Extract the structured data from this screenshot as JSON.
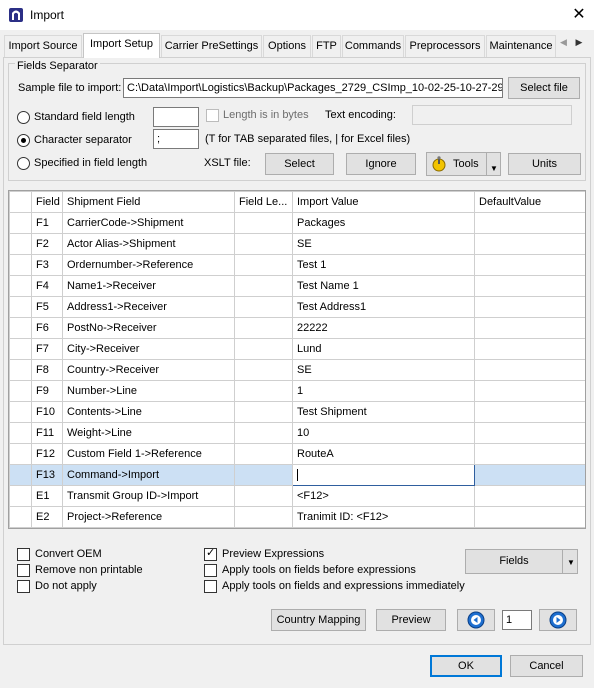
{
  "window": {
    "title": "Import",
    "close_glyph": "✕",
    "icon": "app-logo-icon"
  },
  "tabs": [
    {
      "label": "Import Source",
      "active": false
    },
    {
      "label": "Import Setup",
      "active": true
    },
    {
      "label": "Carrier PreSettings",
      "active": false
    },
    {
      "label": "Options",
      "active": false
    },
    {
      "label": "FTP",
      "active": false
    },
    {
      "label": "Commands",
      "active": false
    },
    {
      "label": "Preprocessors",
      "active": false
    },
    {
      "label": "Maintenance",
      "active": false
    }
  ],
  "tab_scroll": {
    "left": "◀",
    "right": "▶"
  },
  "separator": {
    "legend": "Fields Separator",
    "sample_label": "Sample file to import:",
    "sample_value": "C:\\Data\\Import\\Logistics\\Backup\\Packages_2729_CSImp_10-02-25-10-27-29-",
    "select_file": "Select file",
    "standard_length": "Standard field length",
    "standard_length_value": "",
    "length_in_bytes": "Length is in bytes",
    "text_encoding": "Text encoding:",
    "text_encoding_value": "",
    "character_separator": "Character separator",
    "separator_value": ";",
    "separator_hint": "(T for TAB separated files, | for Excel files)",
    "specified_length": "Specified in field length",
    "xslt_label": "XSLT file:",
    "select": "Select",
    "ignore": "Ignore",
    "tools": "Tools",
    "units": "Units",
    "selected_mode": "character_separator"
  },
  "grid": {
    "columns": [
      "",
      "Field",
      "Shipment Field",
      "Field Le...",
      "Import Value",
      "DefaultValue"
    ],
    "rows": [
      {
        "field": "F1",
        "shipment_field": "CarrierCode->Shipment",
        "field_length": "",
        "import_value": "Packages",
        "default_value": ""
      },
      {
        "field": "F2",
        "shipment_field": "Actor Alias->Shipment",
        "field_length": "",
        "import_value": "SE",
        "default_value": ""
      },
      {
        "field": "F3",
        "shipment_field": "Ordernumber->Reference",
        "field_length": "",
        "import_value": "Test 1",
        "default_value": ""
      },
      {
        "field": "F4",
        "shipment_field": "Name1->Receiver",
        "field_length": "",
        "import_value": "Test Name 1",
        "default_value": ""
      },
      {
        "field": "F5",
        "shipment_field": "Address1->Receiver",
        "field_length": "",
        "import_value": "Test Address1",
        "default_value": ""
      },
      {
        "field": "F6",
        "shipment_field": "PostNo->Receiver",
        "field_length": "",
        "import_value": "22222",
        "default_value": ""
      },
      {
        "field": "F7",
        "shipment_field": "City->Receiver",
        "field_length": "",
        "import_value": "Lund",
        "default_value": ""
      },
      {
        "field": "F8",
        "shipment_field": "Country->Receiver",
        "field_length": "",
        "import_value": "SE",
        "default_value": ""
      },
      {
        "field": "F9",
        "shipment_field": "Number->Line",
        "field_length": "",
        "import_value": "1",
        "default_value": ""
      },
      {
        "field": "F10",
        "shipment_field": "Contents->Line",
        "field_length": "",
        "import_value": "Test Shipment",
        "default_value": ""
      },
      {
        "field": "F11",
        "shipment_field": "Weight->Line",
        "field_length": "",
        "import_value": "10",
        "default_value": ""
      },
      {
        "field": "F12",
        "shipment_field": "Custom Field 1->Reference",
        "field_length": "",
        "import_value": "RouteA",
        "default_value": ""
      },
      {
        "field": "F13",
        "shipment_field": "Command->Import",
        "field_length": "",
        "import_value": "",
        "default_value": "",
        "selected": true
      },
      {
        "field": "E1",
        "shipment_field": "Transmit Group ID->Import",
        "field_length": "",
        "import_value": "<F12>",
        "default_value": ""
      },
      {
        "field": "E2",
        "shipment_field": "Project->Reference",
        "field_length": "",
        "import_value": "Tranimit ID: <F12>",
        "default_value": ""
      }
    ]
  },
  "options": {
    "convert_oem": {
      "label": "Convert OEM",
      "checked": false
    },
    "remove_non_printable": {
      "label": "Remove non printable",
      "checked": false
    },
    "do_not_apply": {
      "label": "Do not apply",
      "checked": false
    },
    "preview_expressions": {
      "label": "Preview Expressions",
      "checked": true
    },
    "apply_tools_before": {
      "label": "Apply tools on fields before expressions",
      "checked": false
    },
    "apply_tools_immediately": {
      "label": "Apply tools on fields and expressions immediately",
      "checked": false
    },
    "fields_button": "Fields"
  },
  "bottom": {
    "country_mapping": "Country Mapping",
    "preview": "Preview",
    "page_value": "1",
    "prev_icon": "previous-circle-icon",
    "next_icon": "next-circle-icon"
  },
  "dialog": {
    "ok": "OK",
    "cancel": "Cancel"
  },
  "colors": {
    "accent": "#0078d7",
    "selection": "#cce0f4"
  }
}
